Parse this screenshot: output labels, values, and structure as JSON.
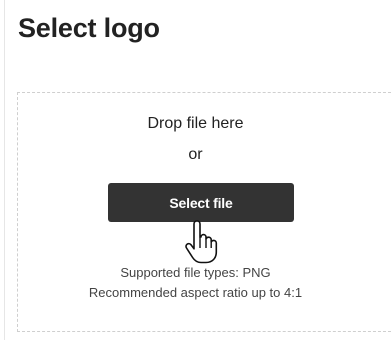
{
  "panel": {
    "title": "Select logo"
  },
  "dropzone": {
    "line1": "Drop file here",
    "line2": "or",
    "button_label": "Select file",
    "supported_types": "Supported file types: PNG",
    "aspect_ratio": "Recommended aspect ratio up to 4:1"
  },
  "icons": {
    "cursor": "hand-pointer-icon"
  }
}
